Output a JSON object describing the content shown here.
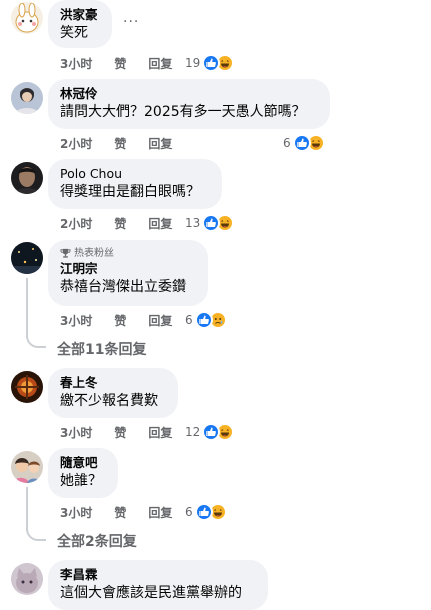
{
  "colors": {
    "bubble": "#f0f2f5",
    "like": "#1877f2",
    "emoji": "#f7b125",
    "muted": "#65676b"
  },
  "comments": [
    {
      "name": "洪家豪",
      "text": "笑死",
      "time": "3小时",
      "like": "赞",
      "reply": "回复",
      "count": "19",
      "reactions": [
        "like-icon",
        "haha-icon"
      ]
    },
    {
      "name": "林冠伶",
      "text": "請問大大們？2025有多一天愚人節嗎？",
      "time": "2小时",
      "like": "赞",
      "reply": "回复",
      "count": "6",
      "reactions": [
        "like-icon",
        "haha-icon"
      ]
    },
    {
      "name": "Polo Chou",
      "text": "得獎理由是翻白眼嗎？",
      "time": "2小时",
      "like": "赞",
      "reply": "回复",
      "count": "13",
      "reactions": [
        "like-icon",
        "haha-icon"
      ]
    },
    {
      "badge": "热表粉丝",
      "name": "江明宗",
      "text": "恭禧台灣傑出立委鑽",
      "time": "3小时",
      "like": "赞",
      "reply": "回复",
      "count": "6",
      "reactions": [
        "like-icon",
        "sad-icon"
      ],
      "view_replies": "全部11条回复"
    },
    {
      "name": "春上冬",
      "text": "繳不少報名費歎",
      "time": "3小时",
      "like": "赞",
      "reply": "回复",
      "count": "12",
      "reactions": [
        "like-icon",
        "haha-icon"
      ]
    },
    {
      "name": "隨意吧",
      "text": "她誰？",
      "time": "3小时",
      "like": "赞",
      "reply": "回复",
      "count": "6",
      "reactions": [
        "like-icon",
        "haha-icon"
      ],
      "view_replies": "全部2条回复"
    },
    {
      "name": "李昌霖",
      "text": "這個大會應該是民進黨舉辦的"
    }
  ],
  "more_label": "···"
}
